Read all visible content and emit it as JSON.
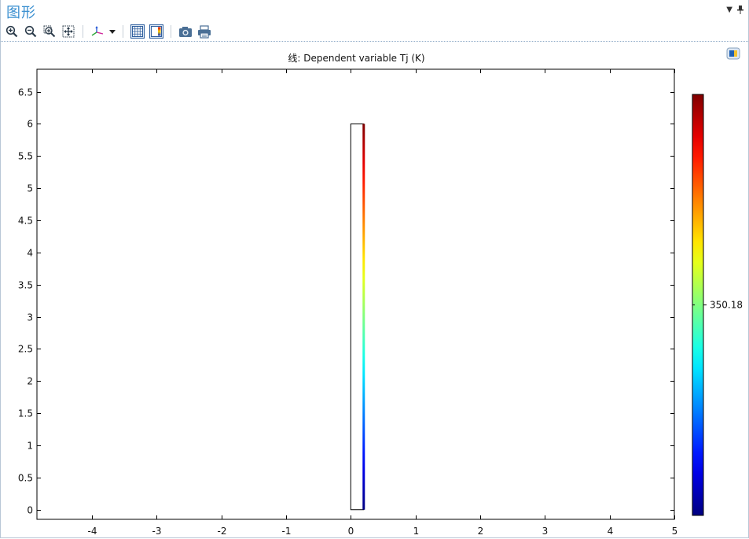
{
  "window": {
    "title": "图形",
    "menu_icon": "chevron-down-icon",
    "pin_icon": "pin-icon"
  },
  "toolbar": {
    "buttons": [
      {
        "name": "zoom-in",
        "icon": "zoom-in-icon"
      },
      {
        "name": "zoom-out",
        "icon": "zoom-out-icon"
      },
      {
        "name": "zoom-box",
        "icon": "zoom-box-icon"
      },
      {
        "name": "zoom-extents",
        "icon": "zoom-extents-icon"
      },
      {
        "name": "axes",
        "icon": "axes-icon"
      },
      {
        "name": "grid",
        "icon": "grid-icon"
      },
      {
        "name": "legend",
        "icon": "legend-icon"
      },
      {
        "name": "snapshot",
        "icon": "camera-icon"
      },
      {
        "name": "print",
        "icon": "printer-icon"
      }
    ]
  },
  "plot": {
    "title": "线: Dependent variable Tj (K)",
    "colorbar_label": "350.18"
  },
  "chart_data": {
    "type": "line",
    "title": "线: Dependent variable Tj (K)",
    "xlabel": "",
    "ylabel": "",
    "xlim": [
      -4.85,
      5.0
    ],
    "ylim": [
      -0.15,
      6.85
    ],
    "x_ticks": [
      "-4",
      "-3",
      "-2",
      "-1",
      "0",
      "1",
      "2",
      "3",
      "4",
      "5"
    ],
    "y_ticks": [
      "0",
      "0.5",
      "1",
      "1.5",
      "2",
      "2.5",
      "3",
      "3.5",
      "4",
      "4.5",
      "5",
      "5.5",
      "6",
      "6.5"
    ],
    "x_tick_values": [
      -4,
      -3,
      -2,
      -1,
      0,
      1,
      2,
      3,
      4,
      5
    ],
    "y_tick_values": [
      0,
      0.5,
      1,
      1.5,
      2,
      2.5,
      3,
      3.5,
      4,
      4.5,
      5,
      5.5,
      6,
      6.5
    ],
    "rectangle": {
      "x": [
        0,
        0.2
      ],
      "y": [
        0,
        6
      ]
    },
    "colored_line": {
      "x": 0.2,
      "y": [
        0,
        6
      ],
      "colormap": "jet"
    },
    "colorbar": {
      "colormap": "jet",
      "labels": [
        "350.18"
      ]
    },
    "grid": false
  },
  "colors": {
    "title_blue": "#3a8fd0",
    "frame": "#000000",
    "dotted_separator": "#8aa7c5"
  }
}
